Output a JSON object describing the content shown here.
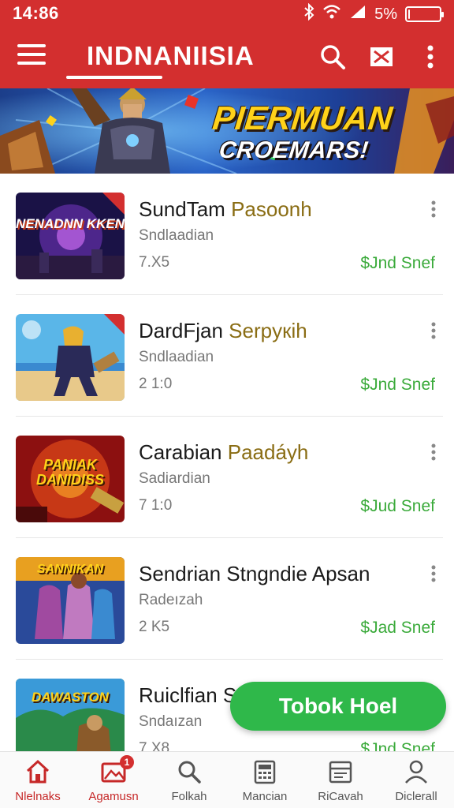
{
  "status_bar": {
    "time": "14:86",
    "battery": "5%",
    "battery_level": 0.05
  },
  "app_bar": {
    "title": "INDNANIISIA"
  },
  "banner": {
    "title_line1": "PIERMUAN",
    "title_line2": "CROEMARS!"
  },
  "items": [
    {
      "title": "SundTam",
      "title_accent": "Pasoonh",
      "subtitle": "Sndlaadian",
      "meta": "7.X5",
      "price": "$Jnd Snef",
      "thumb_text": "NENADNN KKEN",
      "thumb_colors": [
        "#1a1246",
        "#5a2c9c"
      ]
    },
    {
      "title": "DardFjan",
      "title_accent": "Serpyкih",
      "subtitle": "Sndlaadian",
      "meta": "2 1:0",
      "price": "$Jnd Snef",
      "thumb_text": "",
      "thumb_colors": [
        "#5ab6e8",
        "#e8c98a"
      ]
    },
    {
      "title": "Carabian",
      "title_accent": "Paadáyh",
      "subtitle": "Sadiardian",
      "meta": "7 1:0",
      "price": "$Jud Snef",
      "thumb_text": "PANIAK DANIDISS",
      "thumb_colors": [
        "#8c1010",
        "#e04a1a"
      ]
    },
    {
      "title": "Sendrian Stngndie Apsan",
      "title_accent": "",
      "subtitle": "Radeızah",
      "meta": "2 K5",
      "price": "$Jad Snef",
      "thumb_text": "SANNIKAN",
      "thumb_colors": [
        "#2a4a9a",
        "#e8a020"
      ]
    },
    {
      "title": "Ruiclfian S",
      "title_accent": "",
      "subtitle": "Sndaızan",
      "meta": "7 X8",
      "price": "$Jnd Snef",
      "thumb_text": "DAWASTON",
      "thumb_colors": [
        "#1e6a3a",
        "#e0b030"
      ]
    }
  ],
  "fab": {
    "label": "Tobok Hoel"
  },
  "bottom_nav": {
    "items": [
      {
        "label": "Nlelnaks",
        "icon": "home-icon"
      },
      {
        "label": "Agamusn",
        "icon": "image-gallery-icon",
        "badge": "1"
      },
      {
        "label": "Folkah",
        "icon": "search-icon"
      },
      {
        "label": "Mancian",
        "icon": "calculator-icon"
      },
      {
        "label": "RiCavah",
        "icon": "list-card-icon"
      },
      {
        "label": "Diclerall",
        "icon": "profile-icon"
      }
    ]
  },
  "colors": {
    "primary": "#d32f2f",
    "accent_green": "#2fb84a",
    "price_green": "#3aaa3a"
  }
}
